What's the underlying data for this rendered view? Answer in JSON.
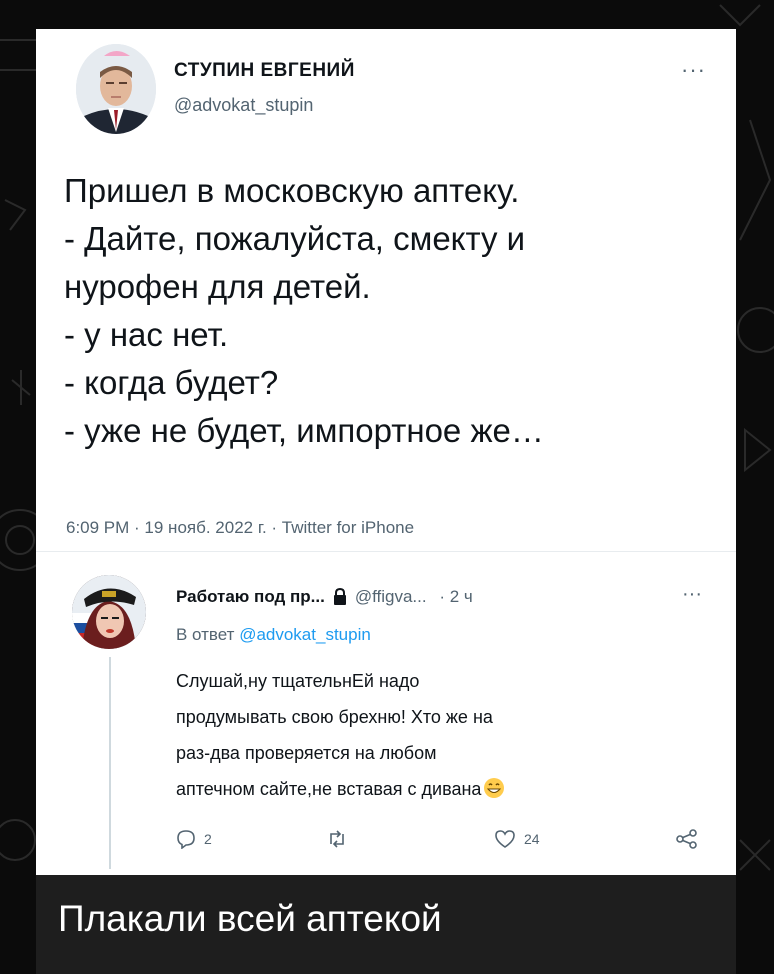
{
  "tweet": {
    "author_name": "СТУПИН ЕВГЕНИЙ",
    "author_handle": "@advokat_stupin",
    "more_label": "···",
    "text_lines": [
      "Пришел в московскую аптеку.",
      "- Дайте, пожалуйста, смекту и",
      "нурофен для детей.",
      "-  у нас нет.",
      "- когда будет?",
      "- уже не будет, импортное же…"
    ],
    "meta": "6:09 PM · 19 нояб. 2022 г. · Twitter for iPhone"
  },
  "reply": {
    "author_name": "Работаю под пр...",
    "author_handle": "@ffigva...",
    "time": "· 2 ч",
    "more_label": "···",
    "reply_to_prefix": "В ответ",
    "reply_to_handle": "@advokat_stupin",
    "text_lines": [
      "Слушай,ну тщательнЕй надо",
      "продумывать свою брехню! Хто же на",
      "раз-два проверяется на любом",
      "аптечном сайте,не вставая с дивана"
    ],
    "emoji": "grinning-face-emoji",
    "actions": {
      "reply_count": "2",
      "retweet_count": "",
      "like_count": "24"
    }
  },
  "caption": "Плакали всей аптекой",
  "colors": {
    "background": "#0b0b0b",
    "card": "#ffffff",
    "caption_bar": "#1e1e1e",
    "text": "#0f1419",
    "secondary": "#536471",
    "link": "#1d9bf0"
  }
}
